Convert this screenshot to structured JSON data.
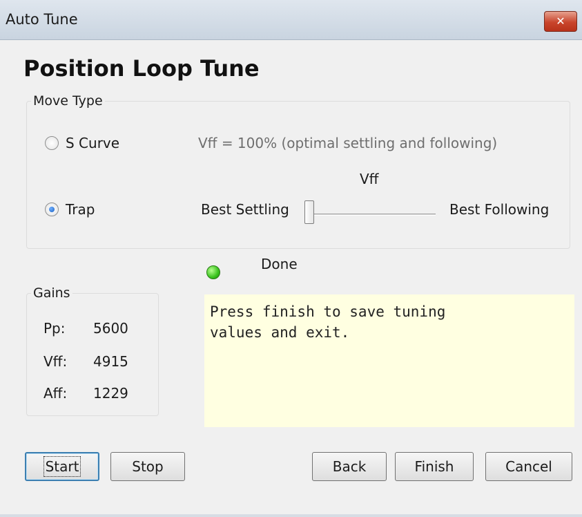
{
  "window": {
    "title": "Auto Tune",
    "close_label": "✕"
  },
  "heading": "Position Loop Tune",
  "move_type": {
    "legend": "Move Type",
    "options": [
      {
        "label": "S Curve",
        "selected": false
      },
      {
        "label": "Trap",
        "selected": true
      }
    ],
    "vff_note": "Vff = 100% (optimal settling and following)",
    "slider": {
      "label": "Vff",
      "min_label": "Best Settling",
      "max_label": "Best Following",
      "value_fraction": 0.0
    }
  },
  "status": {
    "text": "Done",
    "indicator_color": "#39c21d"
  },
  "gains": {
    "legend": "Gains",
    "rows": [
      {
        "key": "Pp:",
        "value": "5600"
      },
      {
        "key": "Vff:",
        "value": "4915"
      },
      {
        "key": "Aff:",
        "value": "1229"
      }
    ]
  },
  "message": "Press finish to save tuning\nvalues and exit.",
  "buttons": {
    "start": "Start",
    "stop": "Stop",
    "back": "Back",
    "finish": "Finish",
    "cancel": "Cancel"
  }
}
